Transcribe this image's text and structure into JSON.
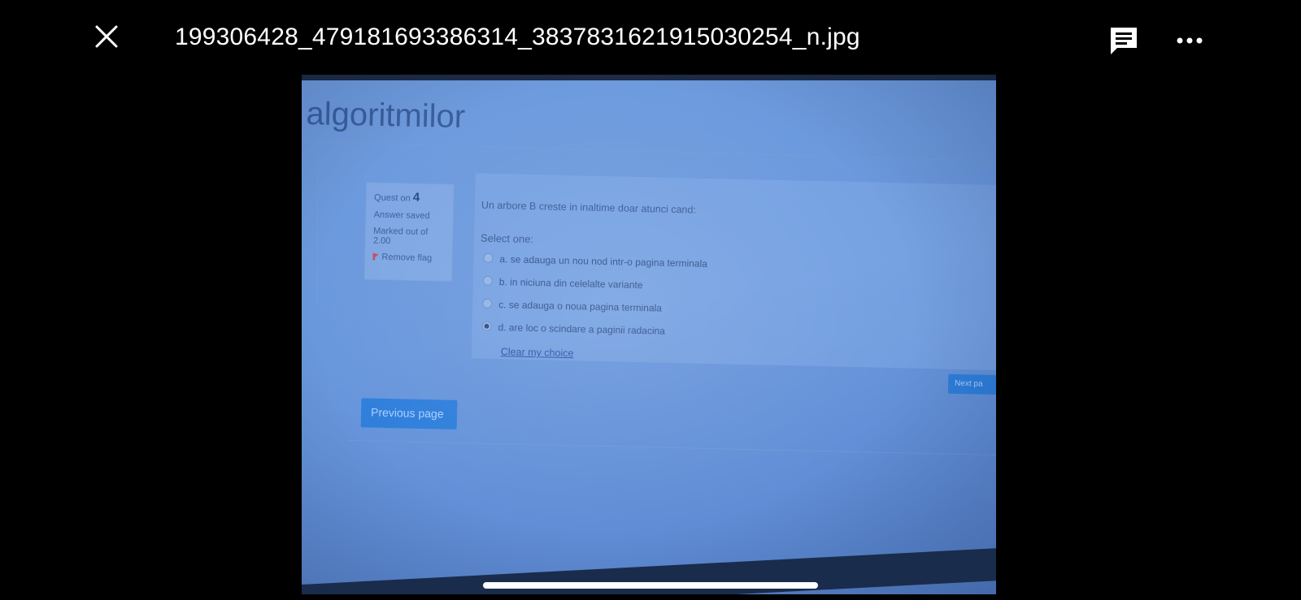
{
  "viewer": {
    "filename": "199306428_479181693386314_3837831621915030254_n.jpg",
    "icons": {
      "close": "close-icon",
      "comment": "comment-icon",
      "more": "more-options-icon"
    }
  },
  "photo": {
    "page_heading": "algoritmilor",
    "question_info": {
      "question_label": "Quest on",
      "question_number": "4",
      "status": "Answer saved",
      "marked_label": "Marked out of",
      "marked_value": "2.00",
      "flag_label": "Remove flag"
    },
    "question_text": "Un arbore B creste in inaltime doar atunci cand:",
    "select_label": "Select one:",
    "options": [
      {
        "label": "a. se adauga un nou nod intr-o pagina terminala",
        "selected": false
      },
      {
        "label": "b. in niciuna din celelalte variante",
        "selected": false
      },
      {
        "label": "c. se adauga o noua pagina terminala",
        "selected": false
      },
      {
        "label": "d. are loc o scindare a paginii radacina",
        "selected": true
      }
    ],
    "clear_choice": "Clear my choice",
    "previous_button": "Previous page",
    "next_button": "Next pa"
  },
  "colors": {
    "background": "#000000",
    "photo_tint": "#6a98dd",
    "button_blue": "#2f7fdb"
  }
}
